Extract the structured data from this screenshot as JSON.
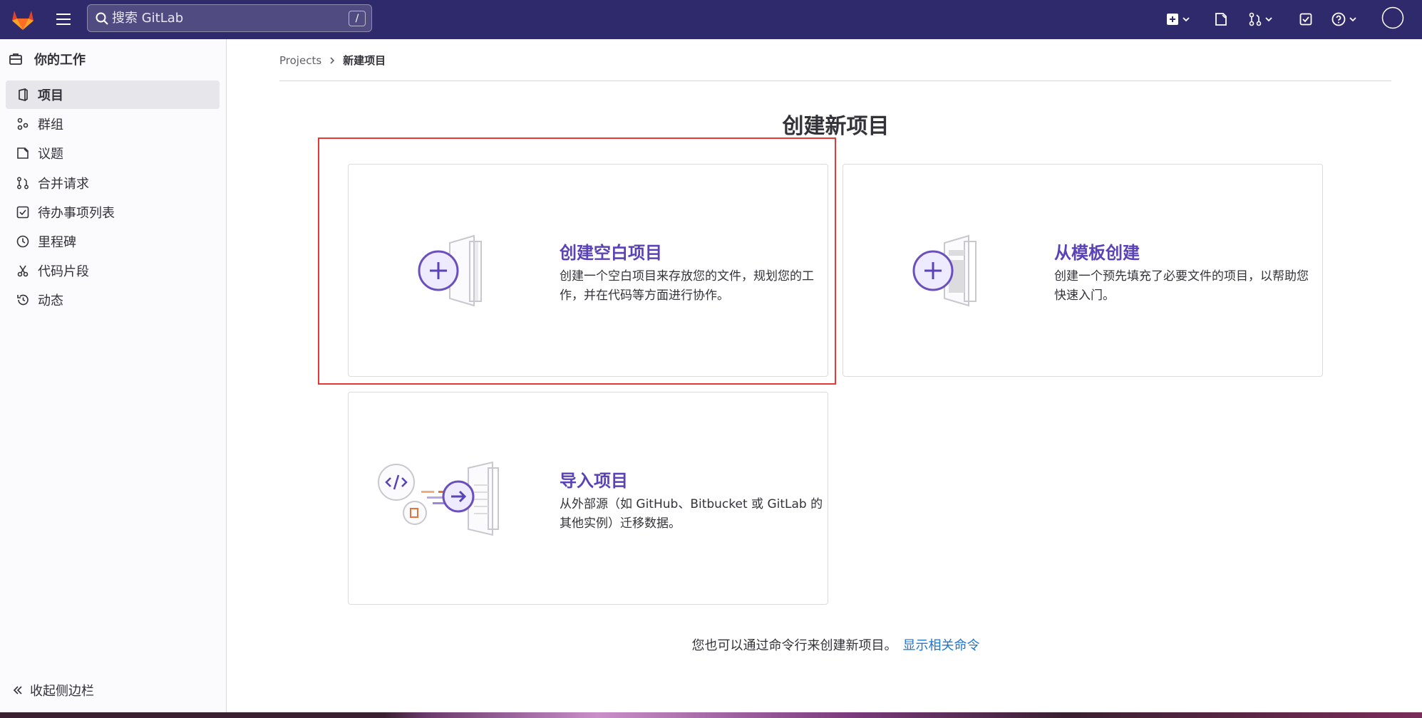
{
  "navbar": {
    "search_placeholder": "搜索 GitLab",
    "search_shortcut": "/"
  },
  "sidebar": {
    "context_title": "你的工作",
    "items": [
      {
        "label": "项目",
        "icon": "project-icon",
        "active": true
      },
      {
        "label": "群组",
        "icon": "group-icon",
        "active": false
      },
      {
        "label": "议题",
        "icon": "issues-icon",
        "active": false
      },
      {
        "label": "合并请求",
        "icon": "merge-request-icon",
        "active": false
      },
      {
        "label": "待办事项列表",
        "icon": "todo-icon",
        "active": false
      },
      {
        "label": "里程碑",
        "icon": "clock-icon",
        "active": false
      },
      {
        "label": "代码片段",
        "icon": "snippet-icon",
        "active": false
      },
      {
        "label": "动态",
        "icon": "history-icon",
        "active": false
      }
    ],
    "collapse_label": "收起侧边栏"
  },
  "breadcrumb": {
    "root": "Projects",
    "current": "新建项目"
  },
  "page_title": "创建新项目",
  "cards": {
    "blank": {
      "title": "创建空白项目",
      "desc": "创建一个空白项目来存放您的文件，规划您的工作，并在代码等方面进行协作。"
    },
    "template": {
      "title": "从模板创建",
      "desc": "创建一个预先填充了必要文件的项目，以帮助您快速入门。"
    },
    "import": {
      "title": "导入项目",
      "desc": "从外部源（如 GitHub、Bitbucket 或 GitLab 的其他实例）迁移数据。"
    }
  },
  "cli": {
    "text": "您也可以通过命令行来创建新项目。",
    "link": "显示相关命令"
  },
  "colors": {
    "navbar": "#2f2a6b",
    "accent": "#5943b6",
    "link": "#1f75cb",
    "highlight": "#e53935"
  }
}
